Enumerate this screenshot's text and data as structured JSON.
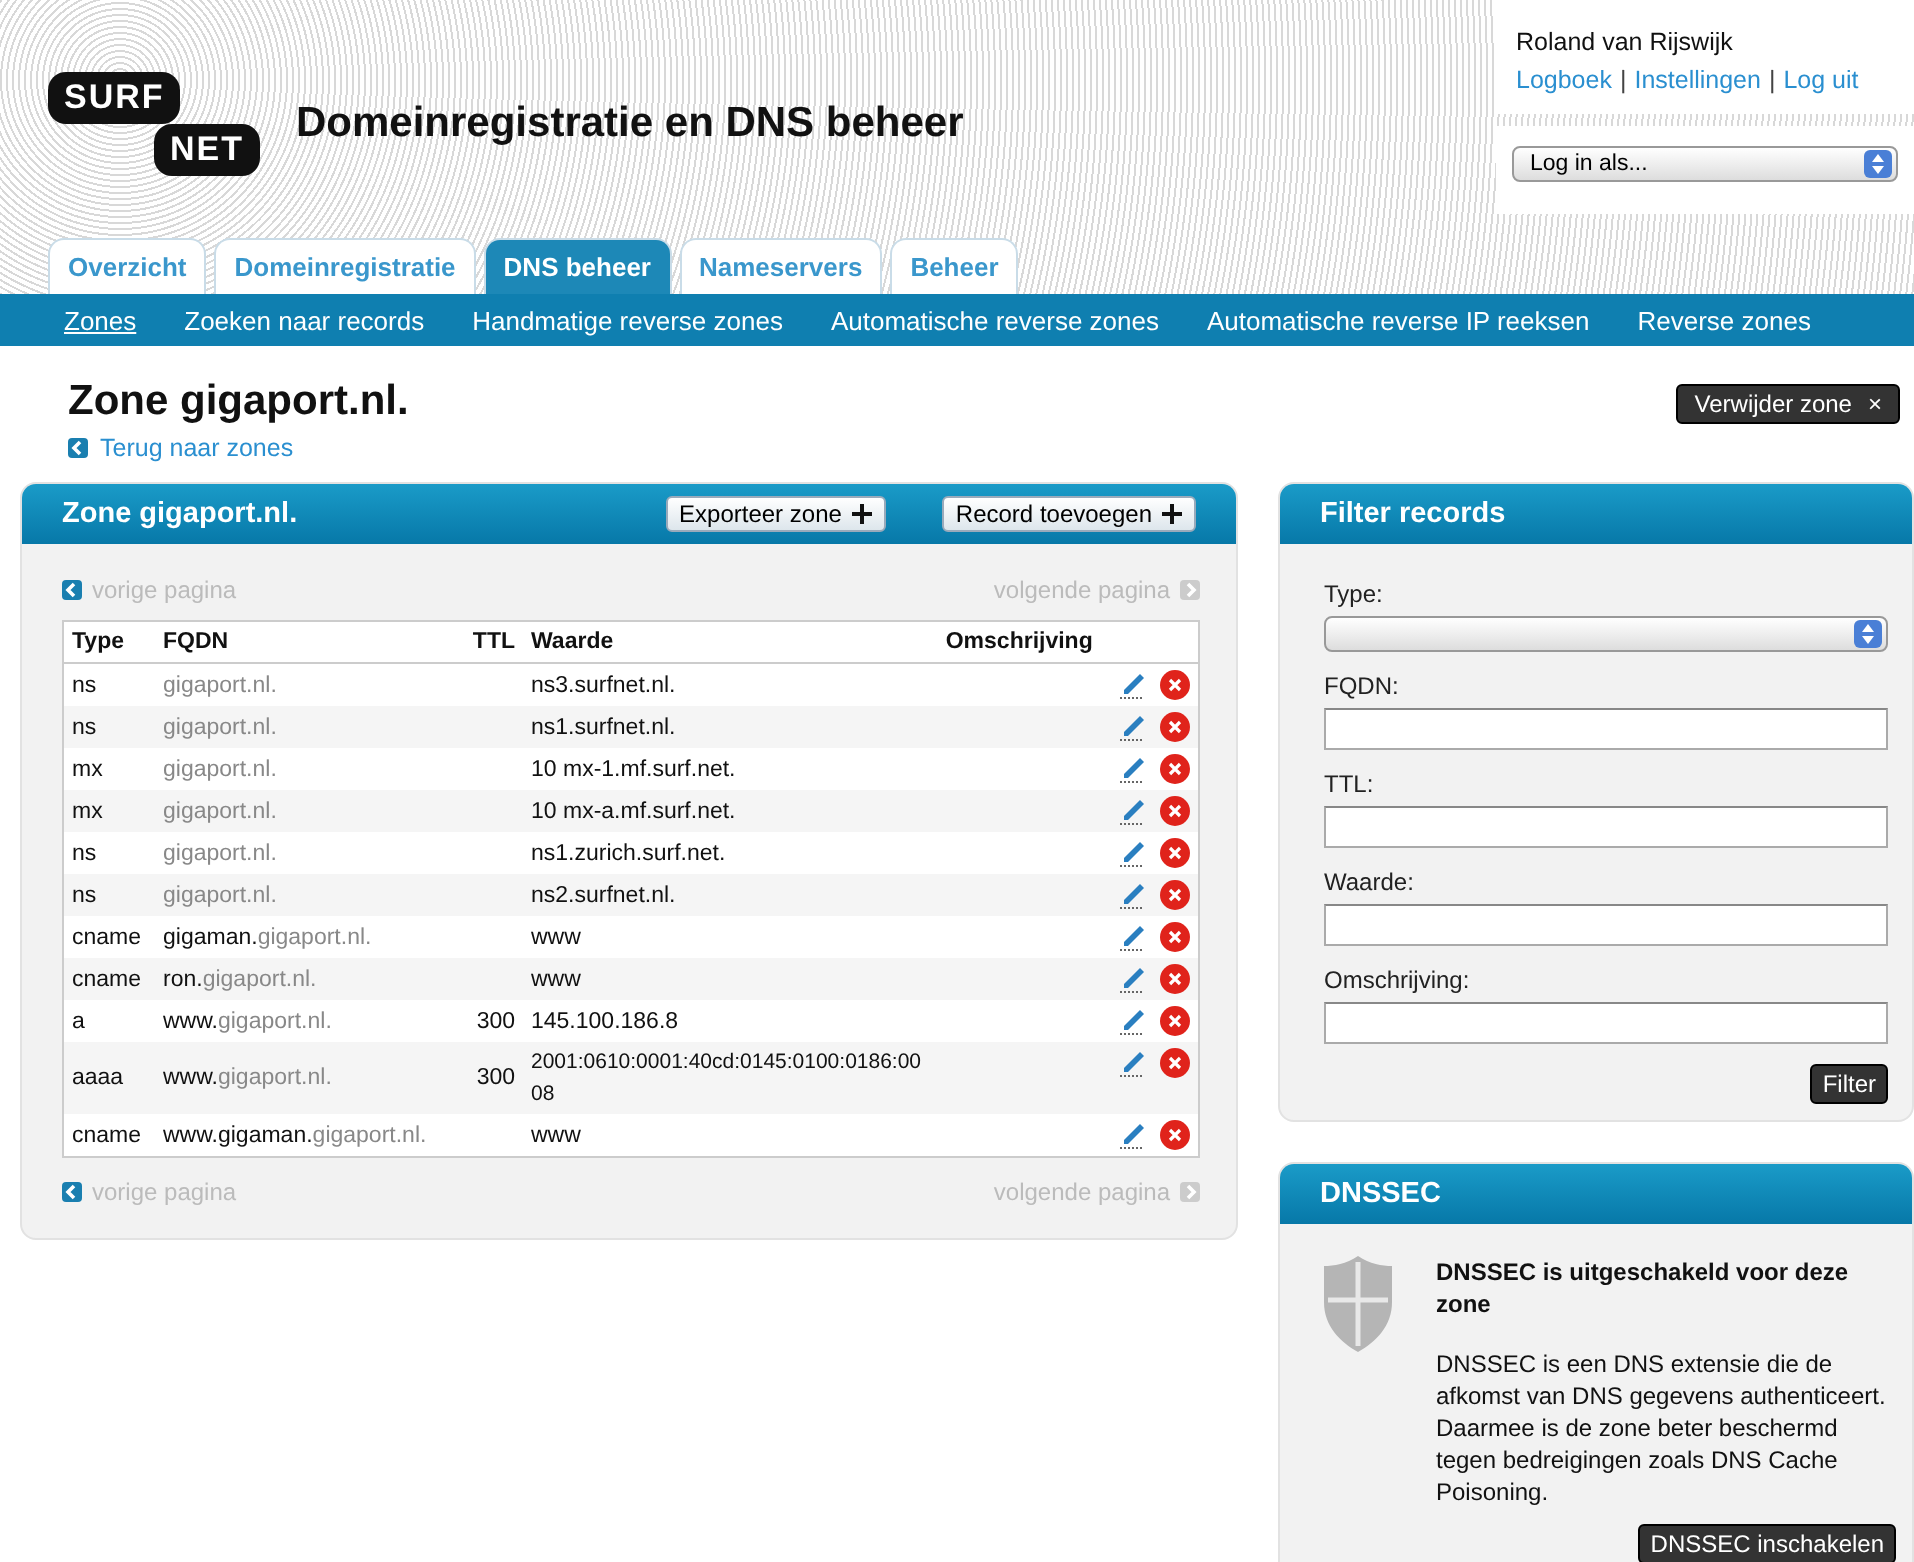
{
  "logo": {
    "line_1": "SURF",
    "line_2": "NET"
  },
  "site_title": "Domeinregistratie en DNS beheer",
  "user": {
    "name": "Roland van Rijswijk",
    "links": [
      "Logboek",
      "Instellingen",
      "Log uit"
    ],
    "separators": [
      "|",
      "|"
    ],
    "login_as": {
      "value": "Log in als..."
    }
  },
  "tabs": [
    {
      "label": "Overzicht",
      "selected": false
    },
    {
      "label": "Domeinregistratie",
      "selected": false
    },
    {
      "label": "DNS beheer",
      "selected": true
    },
    {
      "label": "Nameservers",
      "selected": false
    },
    {
      "label": "Beheer",
      "selected": false
    }
  ],
  "subnav": [
    {
      "label": "Zones",
      "selected": true
    },
    {
      "label": "Zoeken naar records",
      "selected": false
    },
    {
      "label": "Handmatige reverse zones",
      "selected": false
    },
    {
      "label": "Automatische reverse zones",
      "selected": false
    },
    {
      "label": "Automatische reverse IP reeksen",
      "selected": false
    },
    {
      "label": "Reverse zones",
      "selected": false
    }
  ],
  "page": {
    "title": "Zone gigaport.nl.",
    "back_link": "Terug naar zones",
    "delete_button": "Verwijder zone",
    "delete_symbol": "×"
  },
  "zone_panel": {
    "title": "Zone gigaport.nl.",
    "buttons": [
      "Exporteer zone",
      "Record toevoegen"
    ],
    "pager_top": {
      "prev": "vorige pagina",
      "next": "volgende pagina"
    },
    "pager_bottom": {
      "prev": "vorige pagina",
      "next": "volgende pagina"
    },
    "columns": [
      "Type",
      "FQDN",
      "TTL",
      "Waarde",
      "Omschrijving"
    ],
    "rows": [
      {
        "type": "ns",
        "fqdn_prefix": "",
        "fqdn_domain": "gigaport.nl.",
        "ttl": "",
        "value": "ns3.surfnet.nl."
      },
      {
        "type": "ns",
        "fqdn_prefix": "",
        "fqdn_domain": "gigaport.nl.",
        "ttl": "",
        "value": "ns1.surfnet.nl."
      },
      {
        "type": "mx",
        "fqdn_prefix": "",
        "fqdn_domain": "gigaport.nl.",
        "ttl": "",
        "value": "10 mx-1.mf.surf.net."
      },
      {
        "type": "mx",
        "fqdn_prefix": "",
        "fqdn_domain": "gigaport.nl.",
        "ttl": "",
        "value": "10 mx-a.mf.surf.net."
      },
      {
        "type": "ns",
        "fqdn_prefix": "",
        "fqdn_domain": "gigaport.nl.",
        "ttl": "",
        "value": "ns1.zurich.surf.net."
      },
      {
        "type": "ns",
        "fqdn_prefix": "",
        "fqdn_domain": "gigaport.nl.",
        "ttl": "",
        "value": "ns2.surfnet.nl."
      },
      {
        "type": "cname",
        "fqdn_prefix": "gigaman.",
        "fqdn_domain": "gigaport.nl.",
        "ttl": "",
        "value": "www"
      },
      {
        "type": "cname",
        "fqdn_prefix": "ron.",
        "fqdn_domain": "gigaport.nl.",
        "ttl": "",
        "value": "www"
      },
      {
        "type": "a",
        "fqdn_prefix": "www.",
        "fqdn_domain": "gigaport.nl.",
        "ttl": "300",
        "value": "145.100.186.8"
      },
      {
        "type": "aaaa",
        "fqdn_prefix": "www.",
        "fqdn_domain": "gigaport.nl.",
        "ttl": "300",
        "value": "2001:0610:0001:40cd:0145:0100:0186:0008"
      },
      {
        "type": "cname",
        "fqdn_prefix": "www.gigaman.",
        "fqdn_domain": "gigaport.nl.",
        "ttl": "",
        "value": "www"
      }
    ]
  },
  "filter_panel": {
    "title": "Filter records",
    "fields": [
      {
        "label": "Type:",
        "kind": "select"
      },
      {
        "label": "FQDN:",
        "kind": "text"
      },
      {
        "label": "TTL:",
        "kind": "text"
      },
      {
        "label": "Waarde:",
        "kind": "text"
      },
      {
        "label": "Omschrijving:",
        "kind": "text"
      }
    ],
    "button": "Filter"
  },
  "dnssec_panel": {
    "title": "DNSSEC",
    "status": "DNSSEC is uitgeschakeld voor deze zone",
    "description": "DNSSEC is een DNS extensie die de afkomst van DNS gegevens authenticeert. Daarmee is de zone beter beschermd tegen bedreigingen zoals DNS Cache Poisoning.",
    "button": "DNSSEC inschakelen"
  }
}
